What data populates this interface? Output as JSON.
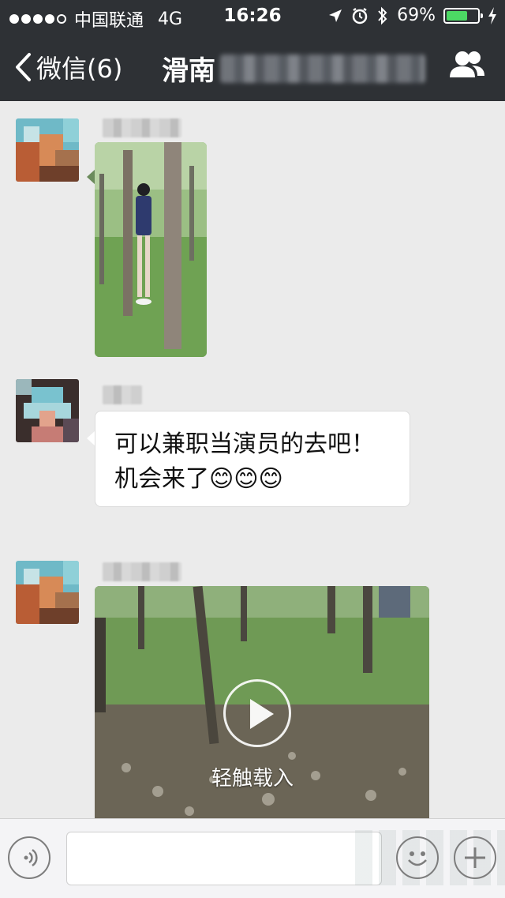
{
  "status_bar": {
    "carrier": "中国联通",
    "network": "4G",
    "time": "16:26",
    "battery": "69%",
    "battery_level": 0.69
  },
  "nav": {
    "back_label": "微信(6)",
    "title": "滑南"
  },
  "messages": [
    {
      "type": "image"
    },
    {
      "type": "text",
      "lines": [
        "可以兼职当演员的去吧！",
        "机会来了😊😊😊"
      ]
    },
    {
      "type": "video",
      "action_label": "轻触载入"
    }
  ],
  "colors": {
    "nav_bg": "#2e3135",
    "chat_bg": "#ebebeb",
    "battery_fill": "#4cd964"
  },
  "icons": [
    "back-chevron-icon",
    "people-icon",
    "voice-icon",
    "emoji-icon",
    "plus-icon",
    "play-icon"
  ]
}
